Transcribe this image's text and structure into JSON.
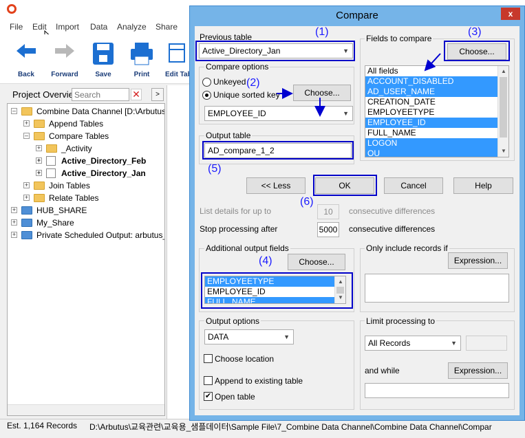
{
  "app": {
    "menu": [
      "File",
      "Edit",
      "Import",
      "Data",
      "Analyze",
      "Share"
    ],
    "toolbar": {
      "back": "Back",
      "forward": "Forward",
      "save": "Save",
      "print": "Print",
      "edit_table": "Edit Tab"
    },
    "project_overview": "Project Overvie",
    "search_placeholder": "Search",
    "tree": [
      "Combine Data Channel [D:\\Arbutus",
      "Append Tables",
      "Compare Tables",
      "_Activity",
      "Active_Directory_Feb",
      "Active_Directory_Jan",
      "Join Tables",
      "Relate Tables",
      "HUB_SHARE",
      "My_Share",
      "Private Scheduled Output:  arbutus_"
    ],
    "status_records": "Est. 1,164 Records",
    "status_path": "D:\\Arbutus\\교육관련\\교육용_샘플데이터\\Sample File\\7_Combine Data Channel\\Combine Data Channel\\Compar"
  },
  "dialog": {
    "title": "Compare",
    "close": "x",
    "previous_table_label": "Previous table",
    "previous_table_value": "Active_Directory_Jan",
    "compare_options_label": "Compare options",
    "unkeyed_label": "Unkeyed",
    "unique_sorted_label": "Unique sorted key",
    "choose_label": "Choose...",
    "key_field_value": "EMPLOYEE_ID",
    "output_table_label": "Output table",
    "output_table_value": "AD_compare_1_2",
    "fields_to_compare_label": "Fields to compare",
    "fields": [
      {
        "name": "All fields",
        "selected": false
      },
      {
        "name": "ACCOUNT_DISABLED",
        "selected": true
      },
      {
        "name": "AD_USER_NAME",
        "selected": true
      },
      {
        "name": "CREATION_DATE",
        "selected": false
      },
      {
        "name": "EMPLOYEETYPE",
        "selected": false
      },
      {
        "name": "EMPLOYEE_ID",
        "selected": true
      },
      {
        "name": "FULL_NAME",
        "selected": false
      },
      {
        "name": "LOGON",
        "selected": true
      },
      {
        "name": "OU",
        "selected": true
      }
    ],
    "less_button": "<< Less",
    "ok_button": "OK",
    "cancel_button": "Cancel",
    "help_button": "Help",
    "list_details_label": "List details for up to",
    "list_details_value": "10",
    "consecutive_diff_1": "consecutive differences",
    "stop_processing_label": "Stop processing after",
    "stop_processing_value": "5000",
    "consecutive_diff_2": "consecutive differences",
    "additional_output_label": "Additional output fields",
    "additional_fields": [
      {
        "name": "EMPLOYEETYPE",
        "selected": true
      },
      {
        "name": "EMPLOYEE_ID",
        "selected": false
      },
      {
        "name": "FULL_NAME",
        "selected": true
      }
    ],
    "only_include_label": "Only include records if",
    "expression_label": "Expression...",
    "output_options_label": "Output options",
    "output_option_value": "DATA",
    "choose_location_label": "Choose location",
    "append_existing_label": "Append to existing table",
    "open_table_label": "Open table",
    "open_table_checked": "✔",
    "limit_processing_label": "Limit processing to",
    "limit_value": "All Records",
    "and_while_label": "and while"
  },
  "annotations": {
    "a1": "(1)",
    "a2": "(2)",
    "a3": "(3)",
    "a4": "(4)",
    "a5": "(5)",
    "a6": "(6)"
  }
}
